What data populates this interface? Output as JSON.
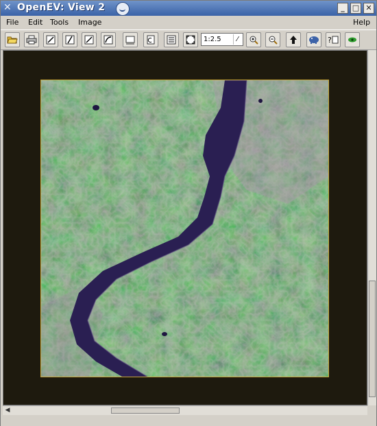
{
  "window": {
    "title": "OpenEV: View  2",
    "controls": {
      "minimize": "_",
      "maximize": "□",
      "close": "✕"
    }
  },
  "menu": [
    "File",
    "Edit",
    "Tools",
    "Image",
    "Help"
  ],
  "toolbar": {
    "icons": [
      "open-folder-icon",
      "print-icon",
      "draw-line-icon",
      "draw-slash-icon",
      "draw-slash2-icon",
      "draw-curve-icon",
      "roi-icon",
      "copy-icon",
      "list-icon",
      "fit-extents-icon",
      "zoom-in-icon",
      "zoom-out-icon",
      "up-arrow-icon",
      "elephant-icon",
      "help-icon",
      "eye-icon"
    ],
    "zoom_value": "1:2.5",
    "zoom_arrow": "⁄"
  },
  "colors": {
    "titlebar": "#3a62a7",
    "view_background": "#1e1a0e",
    "frame_border": "#c8a638",
    "lake": "#2a1f52",
    "vegetation": "#3f8e46"
  },
  "scroll": {
    "left_arrow": "◀",
    "up_arrow": "▲",
    "down_arrow": "▼"
  }
}
